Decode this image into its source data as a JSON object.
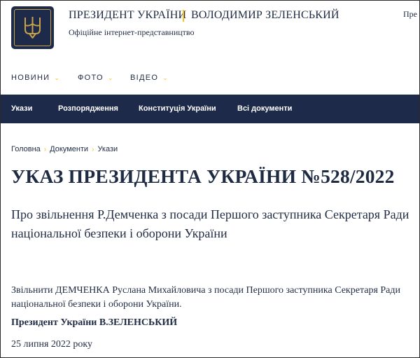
{
  "header": {
    "title": "ПРЕЗИДЕНТ УКРАЇНИ",
    "name": "ВОЛОДИМИР ЗЕЛЕНСЬКИЙ",
    "subtitle": "Офіційне інтернет-представництво",
    "lang_truncated": "Пре",
    "logo_icon": "trident-emblem-icon"
  },
  "topnav": {
    "items": [
      {
        "label": "НОВИНИ"
      },
      {
        "label": "ФОТО"
      },
      {
        "label": "ВІДЕО"
      }
    ]
  },
  "bluebar": {
    "items": [
      {
        "label": "Укази"
      },
      {
        "label": "Розпорядження"
      },
      {
        "label": "Конституція України"
      },
      {
        "label": "Всі документи"
      }
    ]
  },
  "breadcrumb": {
    "items": [
      "Головна",
      "Документи",
      "Укази"
    ]
  },
  "document": {
    "title": "УКАЗ ПРЕЗИДЕНТА УКРАЇНИ №528/2022",
    "subtitle": "Про звільнення Р.Демченка з посади Першого заступника Секретаря Ради національної безпеки і оборони України",
    "body": "Звільнити ДЕМЧЕНКА Руслана Михайловича з посади Першого заступника Секретаря Ради національної безпеки і оборони України.",
    "signature": "Президент України В.ЗЕЛЕНСЬКИЙ",
    "date": "25 липня 2022 року"
  },
  "colors": {
    "navy": "#1e2a4a",
    "accent_yellow": "#f3c316",
    "gold": "#c8a24a",
    "text": "#1f2b43"
  }
}
